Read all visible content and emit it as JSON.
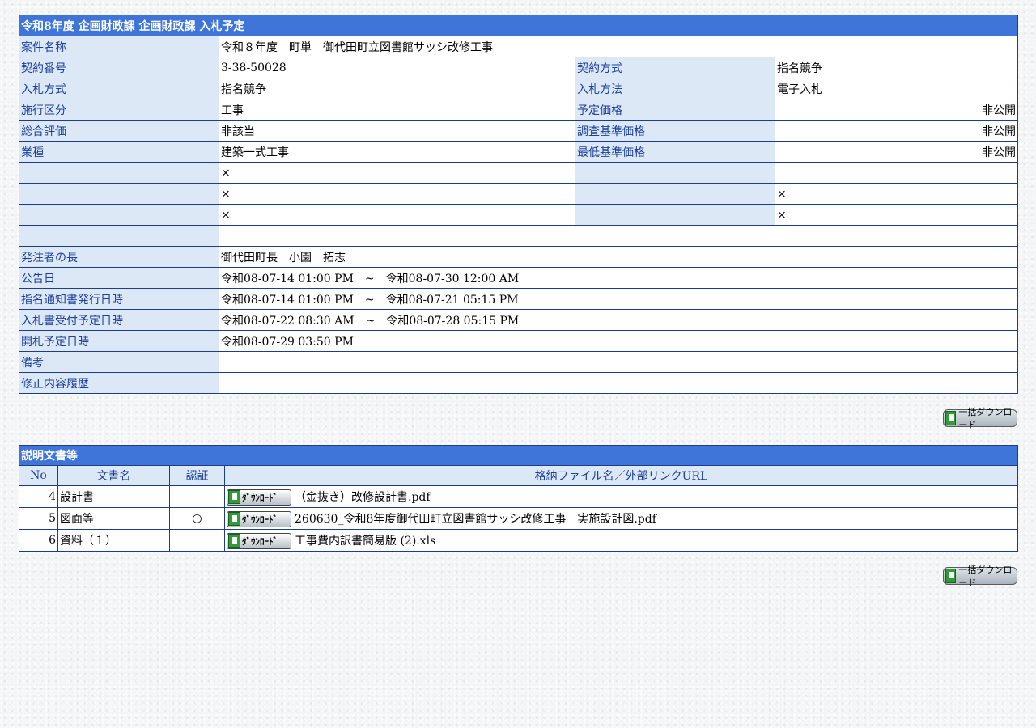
{
  "info": {
    "title": "令和8年度  企画財政課  企画財政課  入札予定",
    "project_label": "案件名称",
    "project_value": "令和８年度　町単　御代田町立図書館サッシ改修工事",
    "rows": [
      {
        "l1": "契約番号",
        "v1": "3-38-50028",
        "l2": "契約方式",
        "v2": "指名競争"
      },
      {
        "l1": "入札方式",
        "v1": "指名競争",
        "l2": "入札方法",
        "v2": "電子入札"
      },
      {
        "l1": "施行区分",
        "v1": "工事",
        "l2": "予定価格",
        "v2": "非公開"
      },
      {
        "l1": "総合評価",
        "v1": "非該当",
        "l2": "調査基準価格",
        "v2": "非公開"
      },
      {
        "l1": "業種",
        "v1": "建築一式工事",
        "l2": "最低基準価格",
        "v2": "非公開"
      },
      {
        "l1": "",
        "v1": "×",
        "l2": "",
        "v2": ""
      },
      {
        "l1": "",
        "v1": "×",
        "l2": "",
        "v2": "×"
      },
      {
        "l1": "",
        "v1": "×",
        "l2": "",
        "v2": "×"
      }
    ],
    "blank_row": {
      "label": "",
      "value": ""
    },
    "wide_rows": [
      {
        "label": "発注者の長",
        "value": "御代田町長　小園　拓志"
      },
      {
        "label": "公告日",
        "value": "令和08-07-14 01:00 PM　~　令和08-07-30 12:00 AM"
      },
      {
        "label": "指名通知書発行日時",
        "value": "令和08-07-14 01:00 PM　~　令和08-07-21 05:15 PM"
      },
      {
        "label": "入札書受付予定日時",
        "value": "令和08-07-22 08:30 AM　~　令和08-07-28 05:15 PM"
      },
      {
        "label": "開札予定日時",
        "value": "令和08-07-29 03:50 PM"
      },
      {
        "label": "備考",
        "value": ""
      },
      {
        "label": "修正内容履歴",
        "value": ""
      }
    ]
  },
  "bulk_download_label": "一括ダウンロード",
  "docs": {
    "title": "説明文書等",
    "headers": {
      "no": "No",
      "name": "文書名",
      "cert": "認証",
      "file": "格納ファイル名／外部リンクURL"
    },
    "download_label": "ﾀﾞｳﾝﾛｰﾄﾞ",
    "rows": [
      {
        "no": "4",
        "name": "設計書",
        "cert": "",
        "file": "（金抜き）改修設計書.pdf"
      },
      {
        "no": "5",
        "name": "図面等",
        "cert": "○",
        "file": "260630_令和8年度御代田町立図書館サッシ改修工事　実施設計図.pdf"
      },
      {
        "no": "6",
        "name": "資料（１）",
        "cert": "",
        "file": "工事費内訳書簡易版 (2).xls"
      }
    ]
  },
  "colors": {
    "header_bg": "#3f74d8",
    "label_bg": "#dde8f6",
    "label_text": "#1a3f9c",
    "border": "#1c3c8c"
  },
  "icons": {
    "download": "download-icon"
  }
}
